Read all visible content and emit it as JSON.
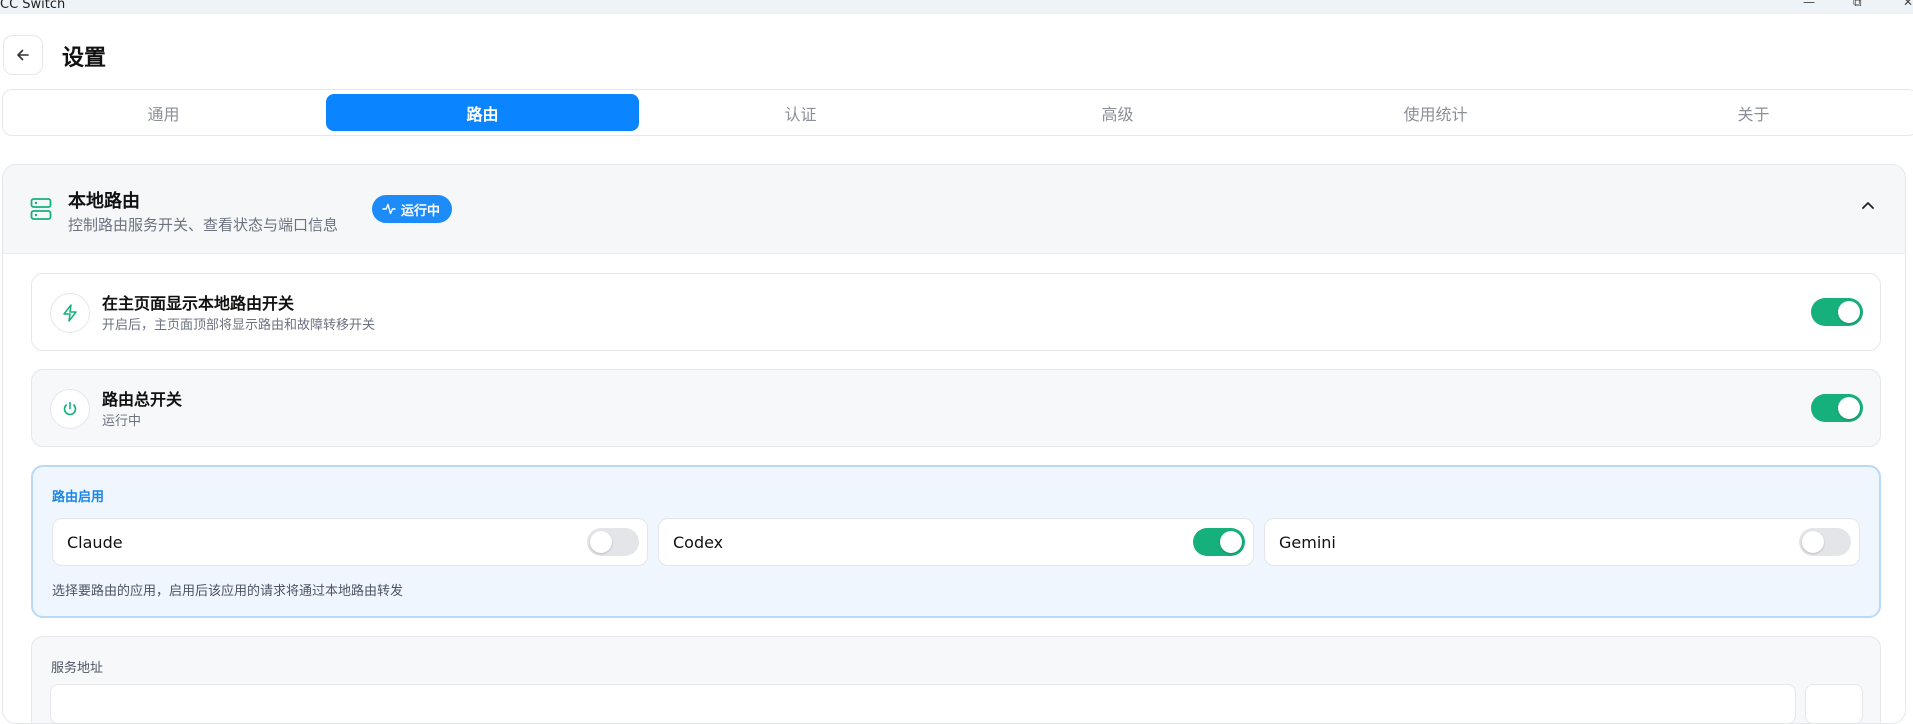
{
  "window": {
    "title": "CC Switch",
    "minimize_icon": "—",
    "maximize_icon": "⧉",
    "close_icon": "✕"
  },
  "header": {
    "title": "设置"
  },
  "tabs": [
    {
      "label": "通用",
      "active": false
    },
    {
      "label": "路由",
      "active": true
    },
    {
      "label": "认证",
      "active": false
    },
    {
      "label": "高级",
      "active": false
    },
    {
      "label": "使用统计",
      "active": false
    },
    {
      "label": "关于",
      "active": false
    }
  ],
  "local_router": {
    "title": "本地路由",
    "subtitle": "控制路由服务开关、查看状态与端口信息",
    "status": "运行中",
    "show_on_home": {
      "title": "在主页面显示本地路由开关",
      "subtitle": "开启后，主页面顶部将显示路由和故障转移开关",
      "enabled": true
    },
    "master_switch": {
      "title": "路由总开关",
      "subtitle": "运行中",
      "enabled": true
    },
    "apps": {
      "label": "路由启用",
      "items": [
        {
          "name": "Claude",
          "enabled": false
        },
        {
          "name": "Codex",
          "enabled": true
        },
        {
          "name": "Gemini",
          "enabled": false
        }
      ],
      "hint": "选择要路由的应用，启用后该应用的请求将通过本地路由转发"
    },
    "service_address": {
      "label": "服务地址"
    }
  },
  "colors": {
    "accent": "#0a84ff",
    "toggle_on": "#16b07c",
    "toggle_off": "#e3e5e8",
    "status_pill": "#1d8cf8"
  }
}
